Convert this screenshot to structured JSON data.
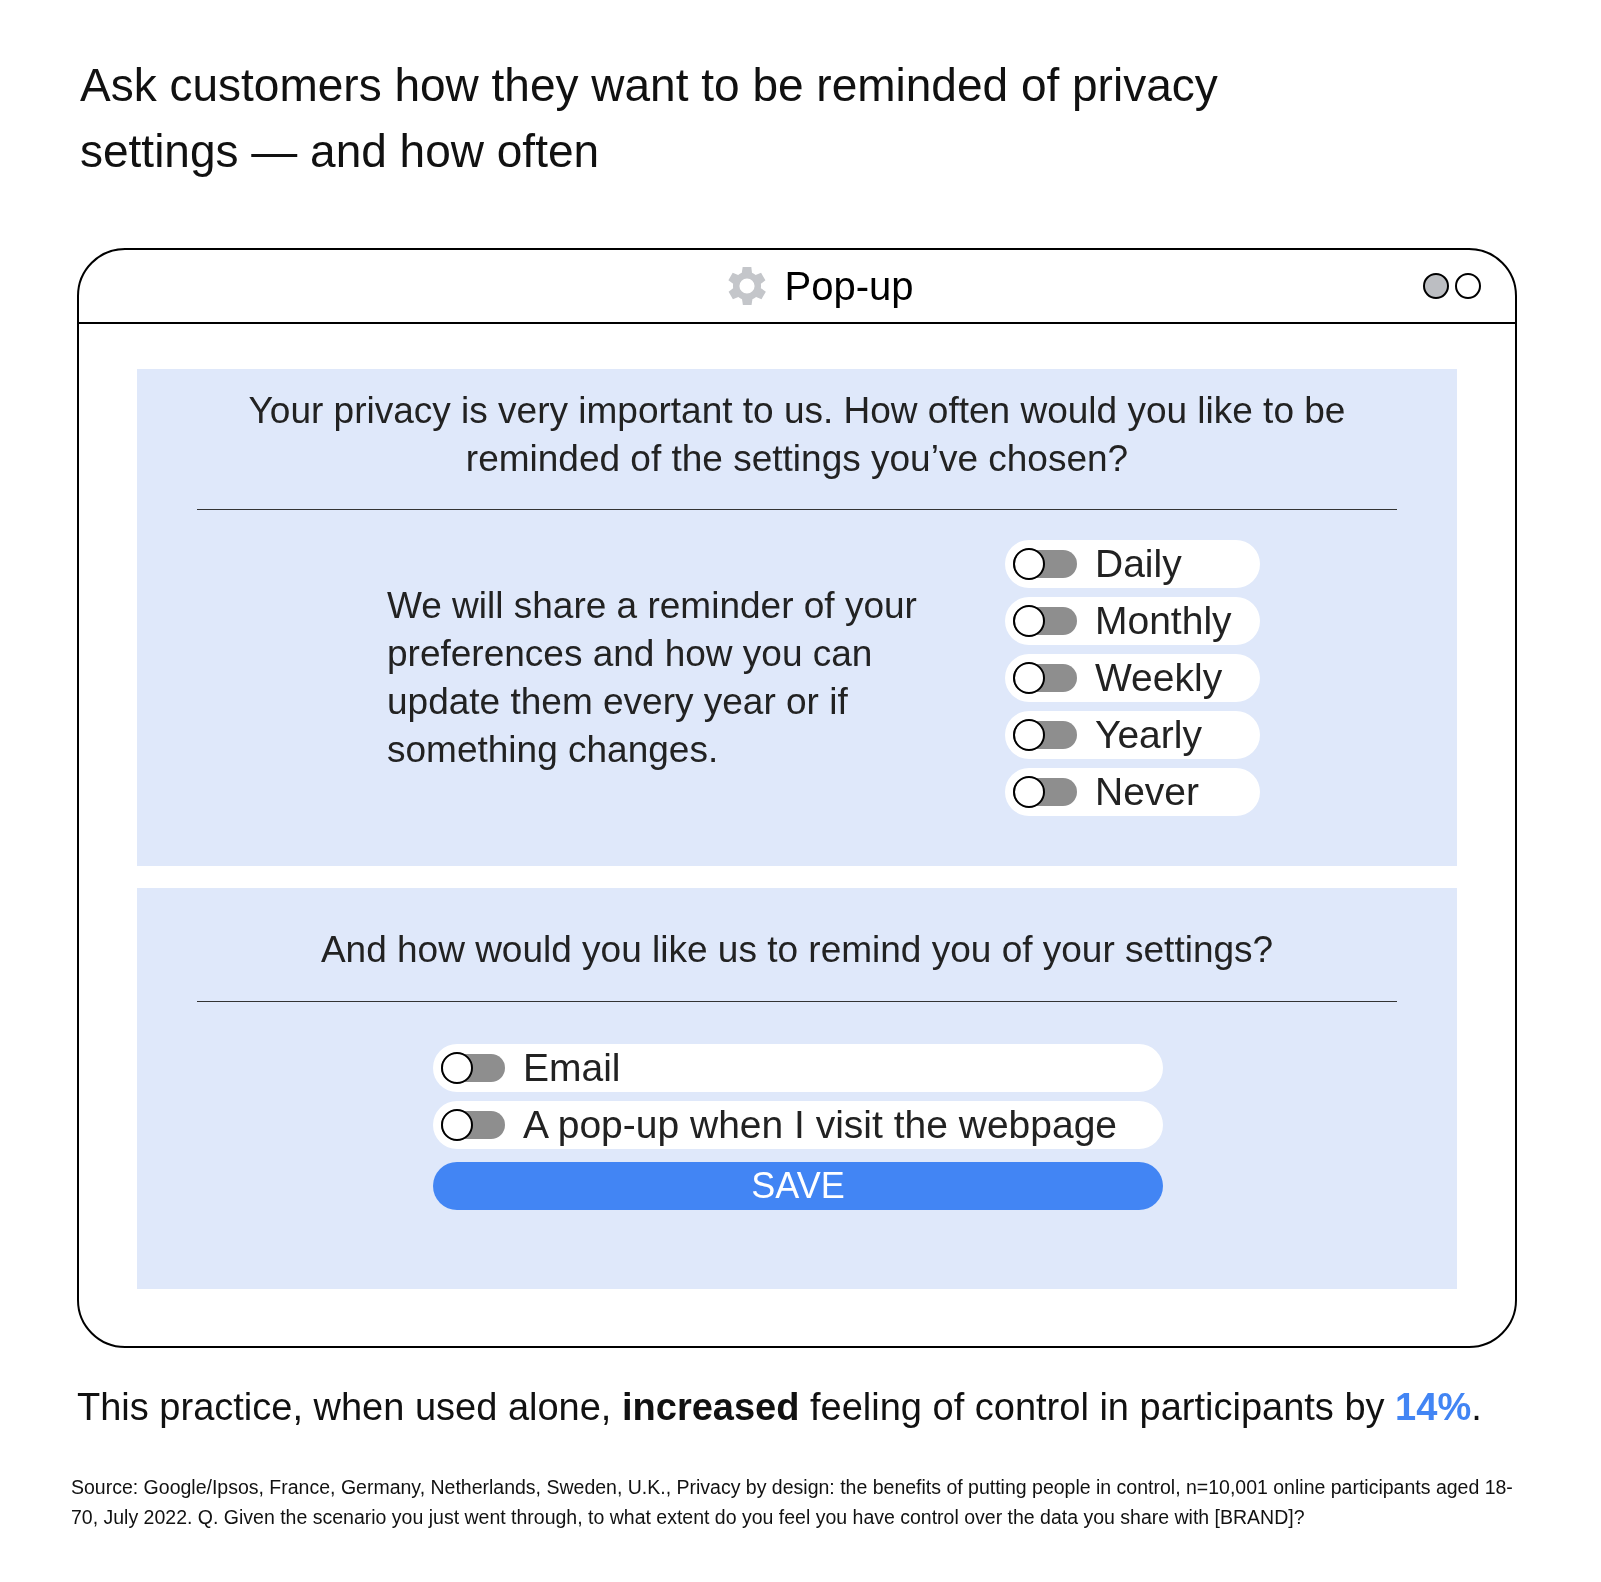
{
  "heading": "Ask customers how they want to be reminded of privacy settings — and how often",
  "window": {
    "title": "Pop-up",
    "controls": [
      {
        "filled": true
      },
      {
        "filled": false
      }
    ]
  },
  "frequency_panel": {
    "question": "Your privacy is very important to us. How often would you like to be reminded of the settings you’ve chosen?",
    "description": "We will share a reminder of your preferences and how you can update them every year or if something changes.",
    "options": [
      {
        "label": "Daily",
        "on": false
      },
      {
        "label": "Monthly",
        "on": false
      },
      {
        "label": "Weekly",
        "on": false
      },
      {
        "label": "Yearly",
        "on": false
      },
      {
        "label": "Never",
        "on": false
      }
    ]
  },
  "method_panel": {
    "question": "And how would you like us to remind you of your settings?",
    "options": [
      {
        "label": "Email",
        "on": false
      },
      {
        "label": "A pop-up when I visit the webpage",
        "on": false
      }
    ],
    "button": "SAVE"
  },
  "finding": "This practice, when used alone, **increased** feeling of control in participants by **14%**.",
  "source": "Source: Google/Ipsos, France, Germany, Netherlands, Sweden, U.K., Privacy by design: the benefits of putting people in control, n=10,001 online participants aged 18-70, July 2022. Q. Given the scenario you just went through, to what extent do you feel you have control over the data you share with [BRAND]?"
}
